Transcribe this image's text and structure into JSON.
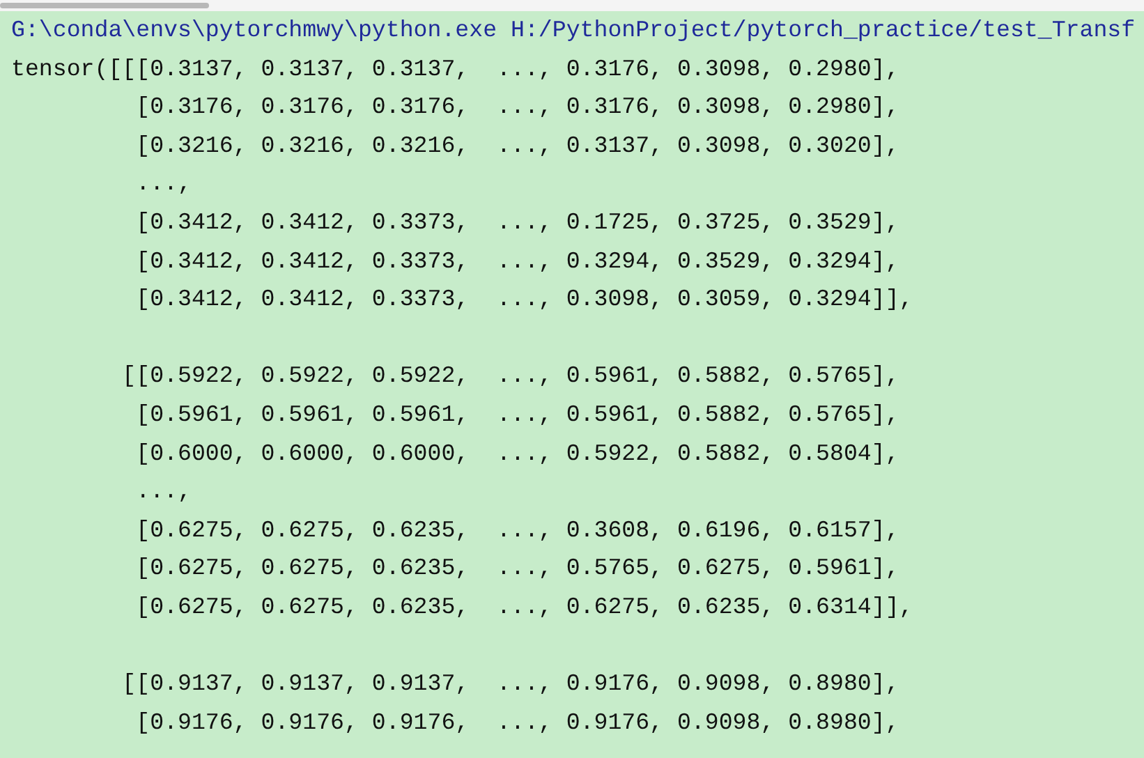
{
  "console": {
    "command": "G:\\conda\\envs\\pytorchmwy\\python.exe H:/PythonProject/pytorch_practice/test_Transf",
    "blocks": [
      [
        "tensor([[[0.3137, 0.3137, 0.3137,  ..., 0.3176, 0.3098, 0.2980],",
        "         [0.3176, 0.3176, 0.3176,  ..., 0.3176, 0.3098, 0.2980],",
        "         [0.3216, 0.3216, 0.3216,  ..., 0.3137, 0.3098, 0.3020],",
        "         ...,",
        "         [0.3412, 0.3412, 0.3373,  ..., 0.1725, 0.3725, 0.3529],",
        "         [0.3412, 0.3412, 0.3373,  ..., 0.3294, 0.3529, 0.3294],",
        "         [0.3412, 0.3412, 0.3373,  ..., 0.3098, 0.3059, 0.3294]],"
      ],
      [
        "        [[0.5922, 0.5922, 0.5922,  ..., 0.5961, 0.5882, 0.5765],",
        "         [0.5961, 0.5961, 0.5961,  ..., 0.5961, 0.5882, 0.5765],",
        "         [0.6000, 0.6000, 0.6000,  ..., 0.5922, 0.5882, 0.5804],",
        "         ...,",
        "         [0.6275, 0.6275, 0.6235,  ..., 0.3608, 0.6196, 0.6157],",
        "         [0.6275, 0.6275, 0.6235,  ..., 0.5765, 0.6275, 0.5961],",
        "         [0.6275, 0.6275, 0.6235,  ..., 0.6275, 0.6235, 0.6314]],"
      ],
      [
        "        [[0.9137, 0.9137, 0.9137,  ..., 0.9176, 0.9098, 0.8980],",
        "         [0.9176, 0.9176, 0.9176,  ..., 0.9176, 0.9098, 0.8980],"
      ]
    ]
  }
}
